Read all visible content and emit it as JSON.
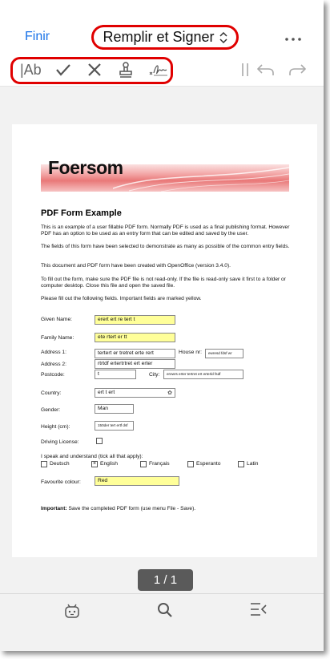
{
  "header": {
    "done_label": "Finir",
    "title": "Remplir et Signer",
    "title_toggle_icon": "chevron-up-down-icon",
    "more_icon": "ellipsis-icon"
  },
  "toolbar": {
    "text_tool_label": "|Ab",
    "tools": [
      "text-tool",
      "checkmark-icon",
      "cross-icon",
      "stamp-icon",
      "signature-icon"
    ],
    "right_tools": [
      "pause-icon",
      "undo-icon",
      "redo-icon"
    ]
  },
  "document": {
    "logo": "Foersom",
    "title": "PDF Form Example",
    "para1": "This is an example of a user fillable PDF form. Normally PDF is used as a final publishing format. However PDF has an option to be used as an entry form that can be edited and saved by the user.",
    "para2": "The fields of this form have been selected to demonstrate as many as possible of the common entry fields.",
    "para3": "This document and PDF form have been created with OpenOffice (version 3.4.0).",
    "para4": "To fill out the form, make sure the PDF file is not read-only. If the file is read-only save it first to a folder or computer desktop. Close this file and open the saved file.",
    "para5": "Please fill out the following fields. Important fields are marked yellow.",
    "labels": {
      "given_name": "Given Name:",
      "family_name": "Family Name:",
      "address1": "Address 1:",
      "house_nr": "House nr:",
      "address2": "Address 2:",
      "postcode": "Postcode:",
      "city": "City:",
      "country": "Country:",
      "gender": "Gender:",
      "height": "Height (cm):",
      "driving": "Driving License:",
      "languages": "I speak and understand (tick all that apply):",
      "colour": "Favourite colour:"
    },
    "values": {
      "given_name": "erert ert re tert t",
      "family_name": "ete rtert er tt",
      "address1": "tertert er tretret  erte rert",
      "house_nr": "ewresd fdsf wr",
      "address2": "rtrtdf ertertrtret ert erter",
      "postcode": "t",
      "city": "erewrs erter tertret ert erterld fsdf",
      "country": "ert t ert",
      "gender": "Man",
      "height": "150der tert ertf dsf",
      "colour": "Red"
    },
    "languages": [
      {
        "label": "Deutsch",
        "checked": false
      },
      {
        "label": "English",
        "checked": true
      },
      {
        "label": "Français",
        "checked": false
      },
      {
        "label": "Esperanto",
        "checked": false
      },
      {
        "label": "Latin",
        "checked": false
      }
    ],
    "important_label": "Important:",
    "important_text": " Save the completed PDF form (use menu File - Save)."
  },
  "page_indicator": "1 / 1",
  "bottom": {
    "icons": [
      "assistant-icon",
      "search-icon",
      "outline-menu-icon"
    ]
  },
  "colors": {
    "accent": "#1a73e8",
    "highlight": "#e00000",
    "field_yellow": "#ffff99"
  }
}
